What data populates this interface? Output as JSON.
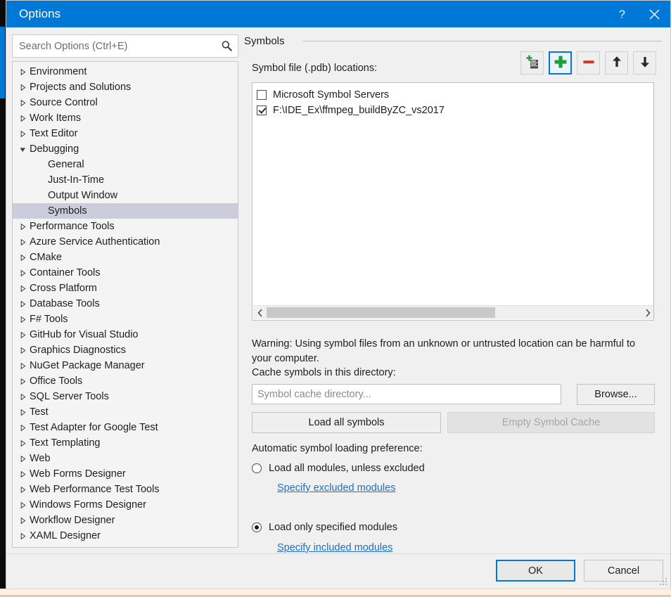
{
  "window": {
    "title": "Options",
    "help_icon": "question-mark-icon",
    "close_icon": "close-icon"
  },
  "search": {
    "placeholder": "Search Options (Ctrl+E)",
    "value": "",
    "icon": "search-icon"
  },
  "tree": {
    "items": [
      {
        "label": "Environment",
        "level": 0,
        "expanded": false,
        "selected": false
      },
      {
        "label": "Projects and Solutions",
        "level": 0,
        "expanded": false,
        "selected": false
      },
      {
        "label": "Source Control",
        "level": 0,
        "expanded": false,
        "selected": false
      },
      {
        "label": "Work Items",
        "level": 0,
        "expanded": false,
        "selected": false
      },
      {
        "label": "Text Editor",
        "level": 0,
        "expanded": false,
        "selected": false
      },
      {
        "label": "Debugging",
        "level": 0,
        "expanded": true,
        "selected": false
      },
      {
        "label": "General",
        "level": 1,
        "expanded": null,
        "selected": false
      },
      {
        "label": "Just-In-Time",
        "level": 1,
        "expanded": null,
        "selected": false
      },
      {
        "label": "Output Window",
        "level": 1,
        "expanded": null,
        "selected": false
      },
      {
        "label": "Symbols",
        "level": 1,
        "expanded": null,
        "selected": true
      },
      {
        "label": "Performance Tools",
        "level": 0,
        "expanded": false,
        "selected": false
      },
      {
        "label": "Azure Service Authentication",
        "level": 0,
        "expanded": false,
        "selected": false
      },
      {
        "label": "CMake",
        "level": 0,
        "expanded": false,
        "selected": false
      },
      {
        "label": "Container Tools",
        "level": 0,
        "expanded": false,
        "selected": false
      },
      {
        "label": "Cross Platform",
        "level": 0,
        "expanded": false,
        "selected": false
      },
      {
        "label": "Database Tools",
        "level": 0,
        "expanded": false,
        "selected": false
      },
      {
        "label": "F# Tools",
        "level": 0,
        "expanded": false,
        "selected": false
      },
      {
        "label": "GitHub for Visual Studio",
        "level": 0,
        "expanded": false,
        "selected": false
      },
      {
        "label": "Graphics Diagnostics",
        "level": 0,
        "expanded": false,
        "selected": false
      },
      {
        "label": "NuGet Package Manager",
        "level": 0,
        "expanded": false,
        "selected": false
      },
      {
        "label": "Office Tools",
        "level": 0,
        "expanded": false,
        "selected": false
      },
      {
        "label": "SQL Server Tools",
        "level": 0,
        "expanded": false,
        "selected": false
      },
      {
        "label": "Test",
        "level": 0,
        "expanded": false,
        "selected": false
      },
      {
        "label": "Test Adapter for Google Test",
        "level": 0,
        "expanded": false,
        "selected": false
      },
      {
        "label": "Text Templating",
        "level": 0,
        "expanded": false,
        "selected": false
      },
      {
        "label": "Web",
        "level": 0,
        "expanded": false,
        "selected": false
      },
      {
        "label": "Web Forms Designer",
        "level": 0,
        "expanded": false,
        "selected": false
      },
      {
        "label": "Web Performance Test Tools",
        "level": 0,
        "expanded": false,
        "selected": false
      },
      {
        "label": "Windows Forms Designer",
        "level": 0,
        "expanded": false,
        "selected": false
      },
      {
        "label": "Workflow Designer",
        "level": 0,
        "expanded": false,
        "selected": false
      },
      {
        "label": "XAML Designer",
        "level": 0,
        "expanded": false,
        "selected": false
      }
    ]
  },
  "panel": {
    "title": "Symbols",
    "pdb_label": "Symbol file (.pdb) locations:",
    "toolbar": [
      {
        "name": "new-symbol-server-button",
        "icon": "server-add-icon",
        "focused": false,
        "enabled": true
      },
      {
        "name": "add-location-button",
        "icon": "plus-icon",
        "focused": true,
        "enabled": true
      },
      {
        "name": "remove-location-button",
        "icon": "minus-icon",
        "focused": false,
        "enabled": true
      },
      {
        "name": "move-up-button",
        "icon": "arrow-up-icon",
        "focused": false,
        "enabled": true
      },
      {
        "name": "move-down-button",
        "icon": "arrow-down-icon",
        "focused": false,
        "enabled": true
      }
    ],
    "locations": [
      {
        "label": "Microsoft Symbol Servers",
        "checked": false
      },
      {
        "label": "F:\\IDE_Ex\\ffmpeg_buildByZC_vs2017",
        "checked": true
      }
    ],
    "scrollbar": {
      "left_arrow": "chevron-left-icon",
      "right_arrow": "chevron-right-icon",
      "thumb_percent": 61
    },
    "warning": "Warning: Using symbol files from an unknown or untrusted location can be harmful to your computer.",
    "cache_label": "Cache symbols in this directory:",
    "cache_placeholder": "Symbol cache directory...",
    "cache_value": "",
    "browse_label": "Browse...",
    "load_all_label": "Load all symbols",
    "empty_cache_label": "Empty Symbol Cache",
    "empty_cache_enabled": false,
    "preference_label": "Automatic symbol loading preference:",
    "radio_all_label": "Load all modules, unless excluded",
    "radio_all_selected": false,
    "link_excluded": "Specify excluded modules",
    "radio_specified_label": "Load only specified modules",
    "radio_specified_selected": true,
    "link_included": "Specify included modules"
  },
  "footer": {
    "ok_label": "OK",
    "cancel_label": "Cancel"
  },
  "colors": {
    "titlebar": "#0078d7",
    "accent": "#0078d7",
    "link": "#1f6fc4",
    "selection": "#ccccdd",
    "dialog_bg": "#f0f0f0"
  }
}
